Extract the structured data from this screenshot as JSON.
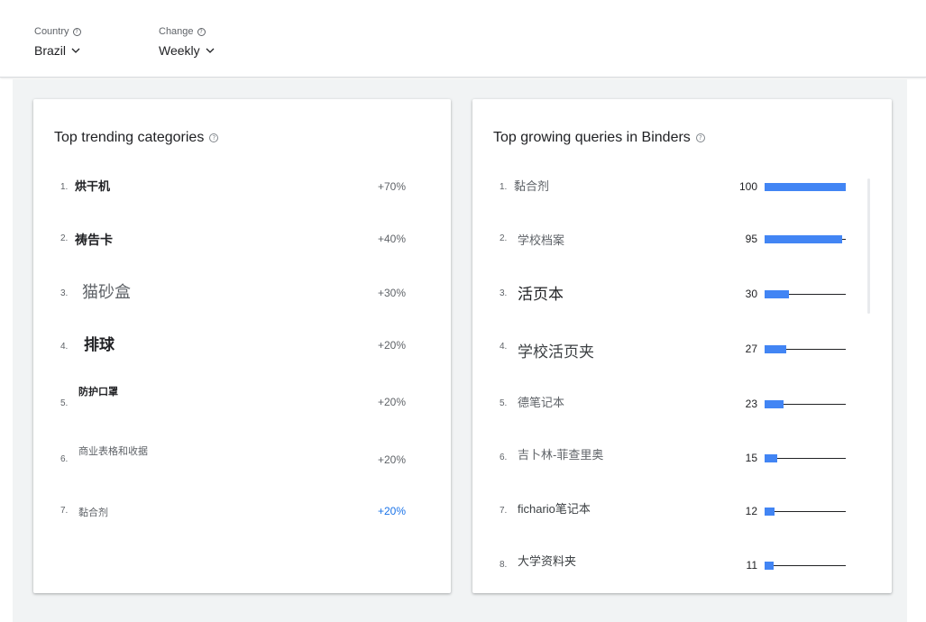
{
  "filters": {
    "country": {
      "label": "Country",
      "value": "Brazil"
    },
    "change": {
      "label": "Change",
      "value": "Weekly"
    }
  },
  "left_card": {
    "title": "Top trending categories",
    "items": [
      {
        "rank": "1.",
        "name": "烘干机",
        "change": "+70%"
      },
      {
        "rank": "2.",
        "name": "祷告卡",
        "change": "+40%"
      },
      {
        "rank": "3.",
        "name": "猫砂盒",
        "change": "+30%"
      },
      {
        "rank": "4.",
        "name": "排球",
        "change": "+20%"
      },
      {
        "rank": "5.",
        "name": "防护口罩",
        "change": "+20%"
      },
      {
        "rank": "6.",
        "name": "商业表格和收据",
        "change": "+20%"
      },
      {
        "rank": "7.",
        "name": "黏合剂",
        "change": "+20%"
      }
    ]
  },
  "right_card": {
    "title": "Top growing queries in Binders",
    "items": [
      {
        "rank": "1.",
        "name": "黏合剂",
        "score": 100
      },
      {
        "rank": "2.",
        "name": "学校档案",
        "score": 95
      },
      {
        "rank": "3.",
        "name": "活页本",
        "score": 30
      },
      {
        "rank": "4.",
        "name": "学校活页夹",
        "score": 27
      },
      {
        "rank": "5.",
        "name": "德笔记本",
        "score": 23
      },
      {
        "rank": "6.",
        "name": "吉卜林-菲查里奥",
        "score": 15
      },
      {
        "rank": "7.",
        "name": "fichario笔记本",
        "score": 12
      },
      {
        "rank": "8.",
        "name": "大学资料夹",
        "score": 11
      }
    ]
  },
  "colors": {
    "accent": "#1a73e8",
    "bar": "#4285f4"
  },
  "icons": {
    "help": "help-circle-icon",
    "dropdown": "chevron-down-icon"
  }
}
